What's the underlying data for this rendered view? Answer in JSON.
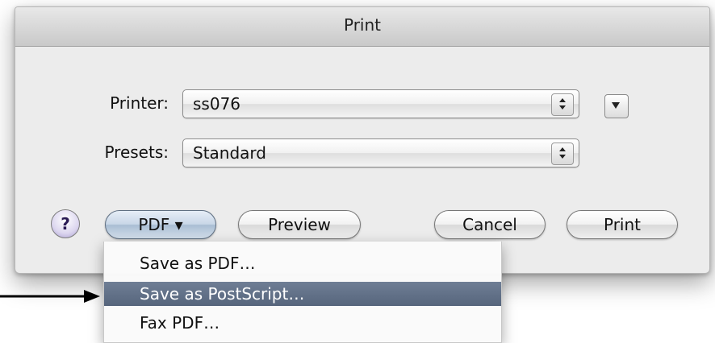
{
  "window": {
    "title": "Print"
  },
  "printer": {
    "label": "Printer:",
    "value": "ss076"
  },
  "presets": {
    "label": "Presets:",
    "value": "Standard"
  },
  "buttons": {
    "help": "?",
    "pdf": "PDF ▾",
    "preview": "Preview",
    "cancel": "Cancel",
    "print": "Print"
  },
  "pdf_menu": {
    "items": [
      "Save as PDF…",
      "Save as PostScript…",
      "Fax PDF…"
    ],
    "selected": "Save as PostScript…"
  },
  "icons": {
    "stepper": "up-down-arrows-icon",
    "disclosure": "triangle-down-icon",
    "pointer": "right-arrow-icon"
  }
}
